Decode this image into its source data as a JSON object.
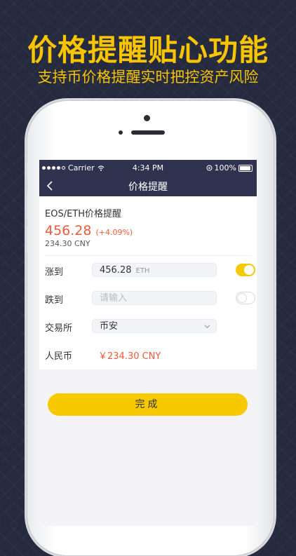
{
  "promo": {
    "headline": "价格提醒贴心功能",
    "subline": "支持币价格提醒实时把控资产风险"
  },
  "status_bar": {
    "carrier": "Carrier",
    "time": "4:34 PM",
    "battery": "100%"
  },
  "nav": {
    "title": "价格提醒"
  },
  "pair": {
    "title": "EOS/ETH价格提醒",
    "price": "456.28",
    "change": "(+4.09%)",
    "cny": "234.30 CNY"
  },
  "rows": {
    "rise": {
      "label": "涨到",
      "value": "456.28",
      "unit": "ETH",
      "toggle_on": true
    },
    "fall": {
      "label": "跌到",
      "placeholder": "请输入",
      "toggle_on": false
    },
    "exchange": {
      "label": "交易所",
      "value": "币安"
    },
    "rmb": {
      "label": "人民币",
      "value": "￥234.30 CNY"
    }
  },
  "done_label": "完成",
  "colors": {
    "accent": "#f6c400",
    "price_red": "#f05a3a",
    "nav_bg": "#2f3350"
  }
}
